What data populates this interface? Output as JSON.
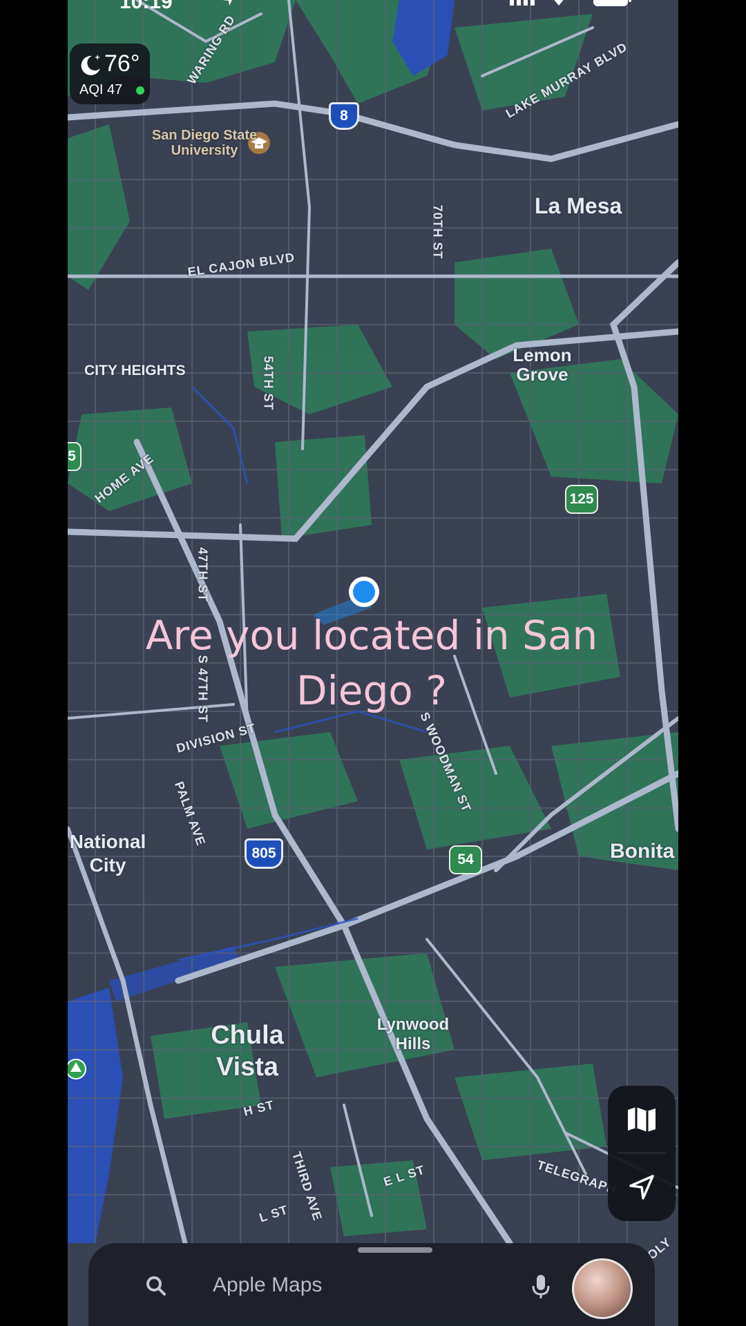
{
  "status_bar": {
    "time": "10:19"
  },
  "weather": {
    "temperature": "76°",
    "aqi_label": "AQI 47",
    "condition_icon": "moon-stars-icon",
    "aqi_status_color": "#2fd35a"
  },
  "map_labels": {
    "sdsu": "San Diego State University",
    "la_mesa": "La Mesa",
    "lemon_grove": "Lemon Grove",
    "city_heights": "CITY HEIGHTS",
    "national_city": "National City",
    "bonita": "Bonita",
    "chula_vista": "Chula Vista",
    "lynwood_hills": "Lynwood Hills"
  },
  "streets": {
    "waring": "WARING RD",
    "lake_murray": "LAKE MURRAY BLVD",
    "el_cajon": "EL CAJON BLVD",
    "seventieth": "70TH ST",
    "fiftyfourth": "54TH ST",
    "home": "HOME AVE",
    "fortyseventh": "47TH ST",
    "s_fortyseventh": "S 47TH ST",
    "division": "DIVISION ST",
    "woodman": "S WOODMAN ST",
    "palm": "PALM AVE",
    "h_st": "H ST",
    "third": "THIRD AVE",
    "e_l_st": "E L ST",
    "l_st": "L ST",
    "telegraph": "TELEGRAPH",
    "olympic": "OLY"
  },
  "shields": {
    "i8": "8",
    "sr125": "125",
    "i805": "805",
    "sr54": "54",
    "sr15": "5"
  },
  "overlay_text": {
    "line1": "Are you located in San",
    "line2": "Diego ?"
  },
  "controls": {
    "map_mode_icon": "map-icon",
    "locate_icon": "location-arrow-icon"
  },
  "search": {
    "placeholder": "Apple Maps"
  },
  "colors": {
    "map_base": "#3a4152",
    "park": "#2f7a5a",
    "road": "#aeb8cc",
    "location_dot": "#1e8cf0",
    "overlay_text": "#f4c6d8",
    "water": "#2a4fb5"
  }
}
